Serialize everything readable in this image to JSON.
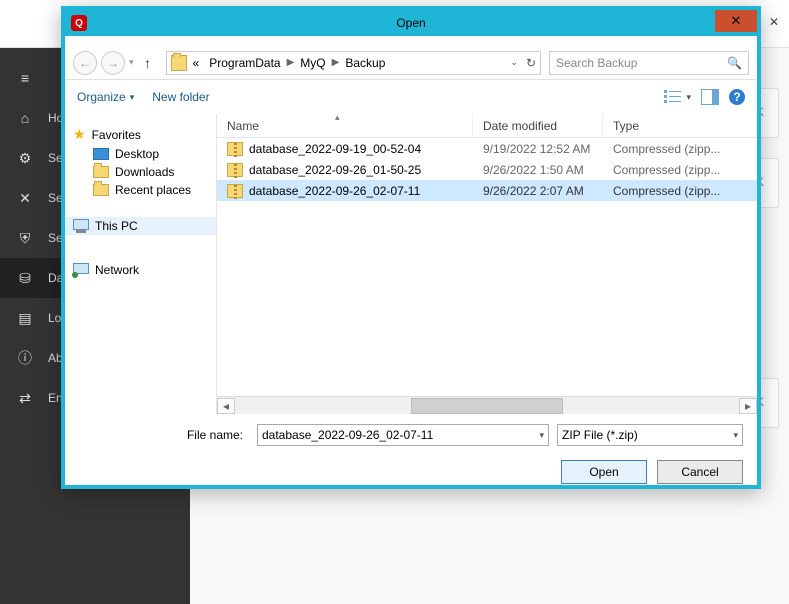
{
  "bg": {
    "sidebar": [
      "Ho",
      "Se",
      "Set",
      "Sec",
      "Dat",
      "Log",
      "Ab",
      "En"
    ],
    "cards_k": "K"
  },
  "dialog": {
    "title": "Open",
    "breadcrumbs": [
      "ProgramData",
      "MyQ",
      "Backup"
    ],
    "search_placeholder": "Search Backup",
    "toolbar": {
      "organize": "Organize",
      "new_folder": "New folder"
    },
    "nav": {
      "favorites": "Favorites",
      "desktop": "Desktop",
      "downloads": "Downloads",
      "recent": "Recent places",
      "this_pc": "This PC",
      "network": "Network"
    },
    "columns": {
      "name": "Name",
      "date": "Date modified",
      "type": "Type"
    },
    "files": [
      {
        "name": "database_2022-09-19_00-52-04",
        "date": "9/19/2022 12:52 AM",
        "type": "Compressed (zipp...",
        "selected": false
      },
      {
        "name": "database_2022-09-26_01-50-25",
        "date": "9/26/2022 1:50 AM",
        "type": "Compressed (zipp...",
        "selected": false
      },
      {
        "name": "database_2022-09-26_02-07-11",
        "date": "9/26/2022 2:07 AM",
        "type": "Compressed (zipp...",
        "selected": true
      }
    ],
    "filename_label": "File name:",
    "filename_value": "database_2022-09-26_02-07-11",
    "filetype": "ZIP File (*.zip)",
    "open_btn": "Open",
    "cancel_btn": "Cancel"
  }
}
